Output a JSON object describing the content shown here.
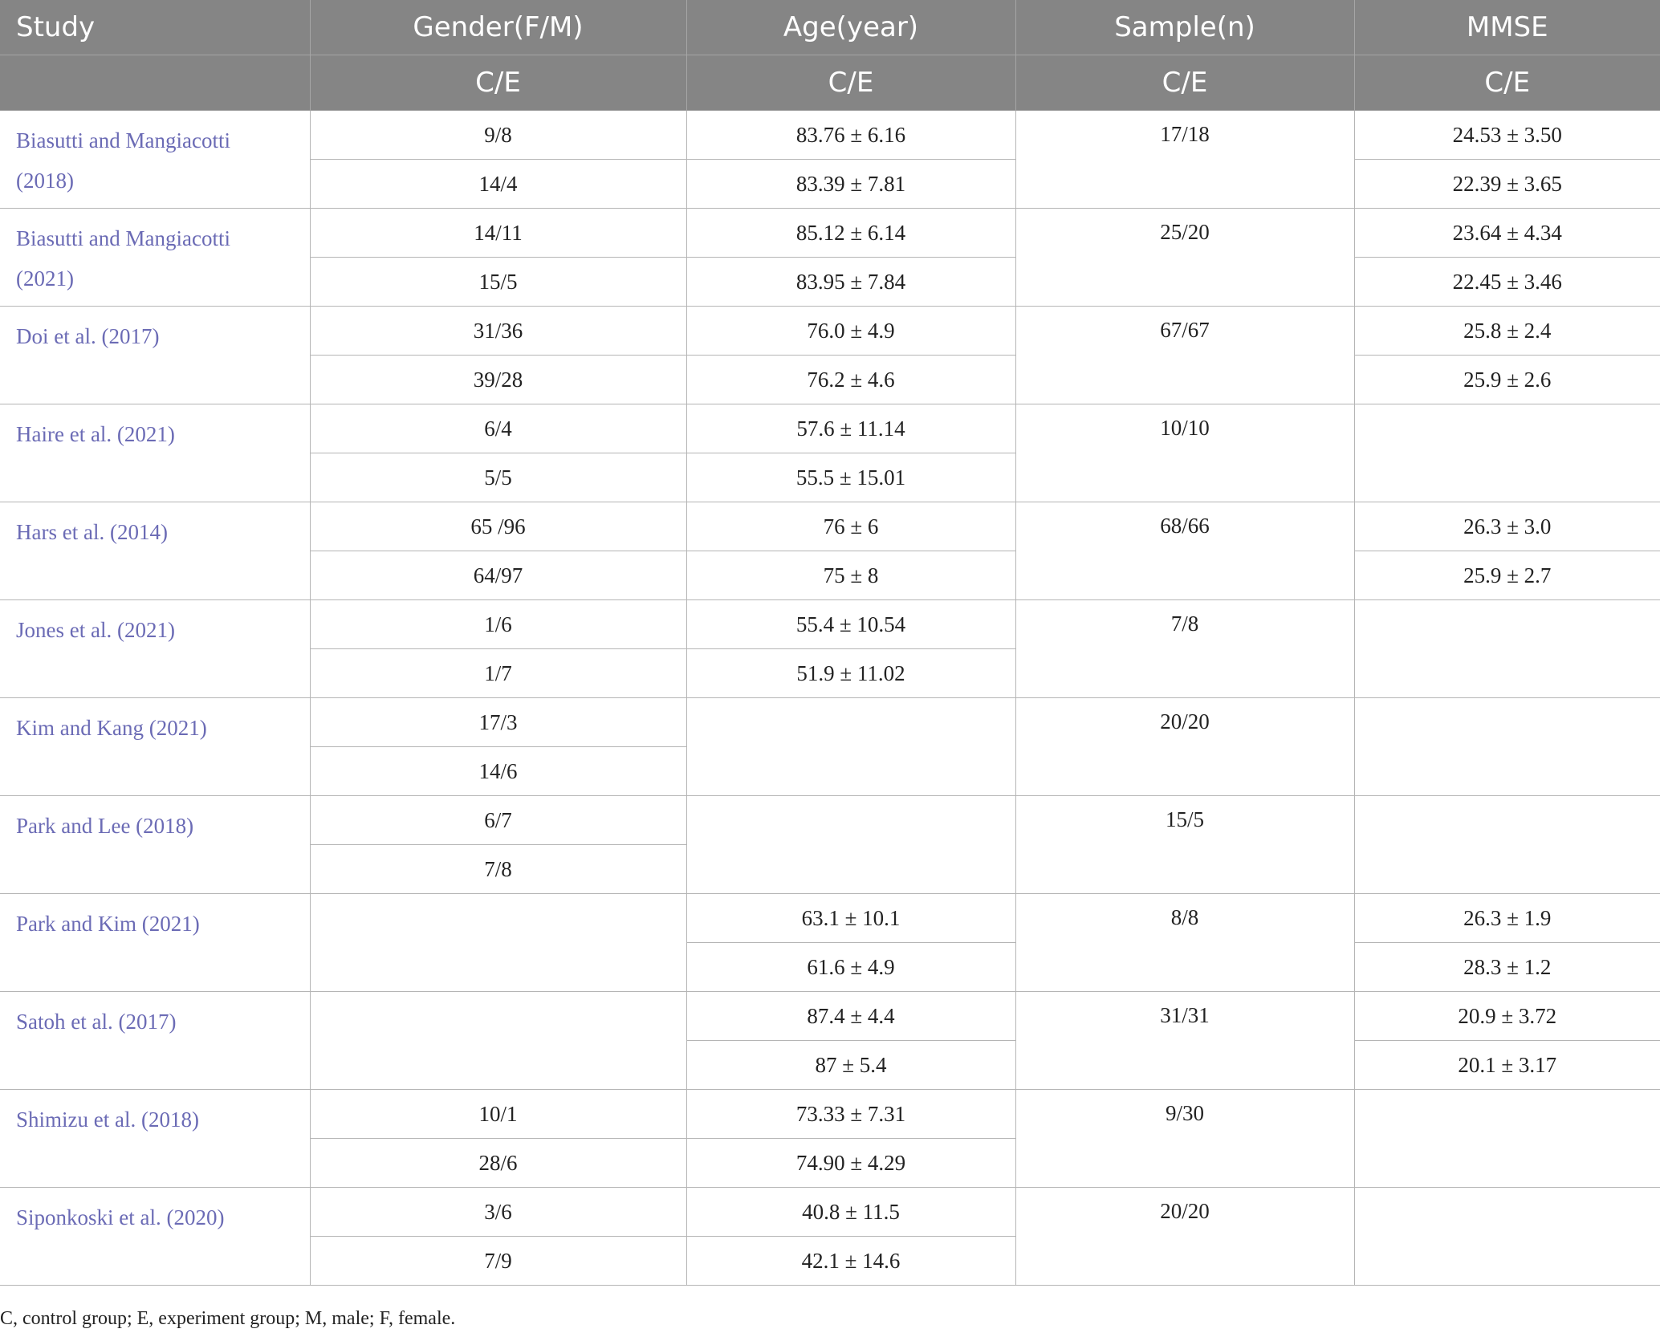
{
  "headers": {
    "study": "Study",
    "gender": "Gender(F/M)",
    "age": "Age(year)",
    "sample": "Sample(n)",
    "mmse": "MMSE",
    "sub": "C/E"
  },
  "studies": [
    {
      "study": "Biasutti and Mangiacotti (2018)",
      "gender": [
        "9/8",
        "14/4"
      ],
      "age": [
        "83.76 ± 6.16",
        "83.39 ± 7.81"
      ],
      "sample": "17/18",
      "mmse": [
        "24.53 ± 3.50",
        "22.39 ± 3.65"
      ]
    },
    {
      "study": "Biasutti and Mangiacotti (2021)",
      "gender": [
        "14/11",
        "15/5"
      ],
      "age": [
        "85.12 ± 6.14",
        "83.95 ± 7.84"
      ],
      "sample": "25/20",
      "mmse": [
        "23.64 ± 4.34",
        "22.45 ± 3.46"
      ]
    },
    {
      "study": "Doi et al. (2017)",
      "gender": [
        "31/36",
        "39/28"
      ],
      "age": [
        "76.0 ± 4.9",
        "76.2 ± 4.6"
      ],
      "sample": "67/67",
      "mmse": [
        "25.8 ± 2.4",
        "25.9 ± 2.6"
      ]
    },
    {
      "study": "Haire et al. (2021)",
      "gender": [
        "6/4",
        "5/5"
      ],
      "age": [
        "57.6 ± 11.14",
        "55.5 ± 15.01"
      ],
      "sample": "10/10",
      "mmse": null
    },
    {
      "study": "Hars et al. (2014)",
      "gender": [
        "65 /96",
        "64/97"
      ],
      "age": [
        "76 ± 6",
        "75 ± 8"
      ],
      "sample": "68/66",
      "mmse": [
        "26.3 ± 3.0",
        "25.9 ± 2.7"
      ]
    },
    {
      "study": "Jones et al. (2021)",
      "gender": [
        "1/6",
        "1/7"
      ],
      "age": [
        "55.4 ± 10.54",
        "51.9 ± 11.02"
      ],
      "sample": "7/8",
      "mmse": null
    },
    {
      "study": "Kim and Kang (2021)",
      "gender": [
        "17/3",
        "14/6"
      ],
      "age": null,
      "sample": "20/20",
      "mmse": null
    },
    {
      "study": "Park and Lee (2018)",
      "gender": [
        "6/7",
        "7/8"
      ],
      "age": null,
      "sample": "15/5",
      "mmse": null
    },
    {
      "study": "Park and Kim (2021)",
      "gender": null,
      "age": [
        "63.1 ± 10.1",
        "61.6 ± 4.9"
      ],
      "sample": "8/8",
      "mmse": [
        "26.3 ± 1.9",
        "28.3 ± 1.2"
      ]
    },
    {
      "study": "Satoh et al. (2017)",
      "gender": null,
      "age": [
        "87.4 ± 4.4",
        "87 ± 5.4"
      ],
      "sample": "31/31",
      "mmse": [
        "20.9 ± 3.72",
        "20.1 ± 3.17"
      ]
    },
    {
      "study": "Shimizu et al. (2018)",
      "gender": [
        "10/1",
        "28/6"
      ],
      "age": [
        "73.33 ± 7.31",
        "74.90 ± 4.29"
      ],
      "sample": "9/30",
      "mmse": null
    },
    {
      "study": "Siponkoski et al. (2020)",
      "gender": [
        "3/6",
        "7/9"
      ],
      "age": [
        "40.8 ± 11.5",
        "42.1 ± 14.6"
      ],
      "sample": "20/20",
      "mmse": null
    }
  ],
  "footnote": "C, control group; E, experiment group; M, male; F, female."
}
